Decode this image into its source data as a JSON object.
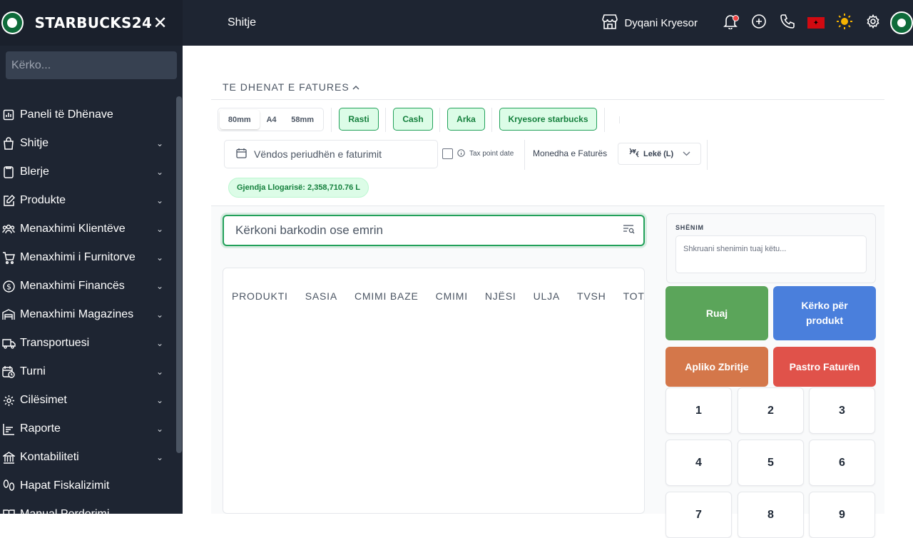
{
  "sidebar": {
    "brand": "STARBUCKS24",
    "search_placeholder": "Kërko...",
    "items": [
      {
        "label": "Paneli të Dhënave",
        "icon": "chart-icon",
        "expandable": false
      },
      {
        "label": "Shitje",
        "icon": "shopping-bag-icon",
        "expandable": true
      },
      {
        "label": "Blerje",
        "icon": "clipboard-icon",
        "expandable": true
      },
      {
        "label": "Produkte",
        "icon": "edit-icon",
        "expandable": true
      },
      {
        "label": "Menaxhimi Klientëve",
        "icon": "users-icon",
        "expandable": true
      },
      {
        "label": "Menaxhimi i Furnitorve",
        "icon": "cart-icon",
        "expandable": true
      },
      {
        "label": "Menaxhimi Financës",
        "icon": "dollar-icon",
        "expandable": true
      },
      {
        "label": "Menaxhimi Magazines",
        "icon": "warehouse-icon",
        "expandable": true
      },
      {
        "label": "Transportuesi",
        "icon": "truck-icon",
        "expandable": true
      },
      {
        "label": "Turni",
        "icon": "calendar-clock-icon",
        "expandable": true
      },
      {
        "label": "Cilësimet",
        "icon": "gear-icon",
        "expandable": true
      },
      {
        "label": "Raporte",
        "icon": "report-icon",
        "expandable": true
      },
      {
        "label": "Kontabiliteti",
        "icon": "bank-icon",
        "expandable": true
      },
      {
        "label": "Hapat Fiskalizimit",
        "icon": "steps-icon",
        "expandable": false
      },
      {
        "label": "Manual Perdorimi",
        "icon": "book-icon",
        "expandable": false
      }
    ]
  },
  "topbar": {
    "title": "Shitje",
    "store": "Dyqani Kryesor"
  },
  "invoice": {
    "section_title": "TE DHENAT E FATURES",
    "formats": [
      "80mm",
      "A4",
      "58mm"
    ],
    "selected_format": "80mm",
    "pills": [
      "Rasti",
      "Cash",
      "Arka",
      "Kryesore starbucks"
    ],
    "date_placeholder": "Vëndos periudhën e faturimit",
    "tax_point_label": "Tax point date",
    "currency_label": "Monedha e Faturës",
    "currency_value": "Lekë (L)",
    "balance": "Gjendja Llogarisë: 2,358,710.76 L"
  },
  "products": {
    "search_placeholder": "Kërkoni barkodin ose emrin",
    "columns": [
      "PRODUKTI",
      "SASIA",
      "CMIMI BAZE",
      "CMIMI",
      "NJËSI",
      "ULJA",
      "TVSH",
      "TOTAL"
    ]
  },
  "note": {
    "label": "SHËNIM",
    "placeholder": "Shkruani shenimin tuaj këtu..."
  },
  "actions": {
    "save": "Ruaj",
    "search_product": "Kërko për produkt",
    "discount": "Apliko Zbritje",
    "clear": "Pastro Faturën"
  },
  "keypad": [
    "1",
    "2",
    "3",
    "4",
    "5",
    "6",
    "7",
    "8",
    "9"
  ],
  "colors": {
    "sidebar_bg": "#1e2532",
    "accent_green": "#22a15a",
    "save": "#5ba55a",
    "search_product": "#4a7fdc",
    "discount": "#d4774a",
    "clear": "#e0524a"
  }
}
